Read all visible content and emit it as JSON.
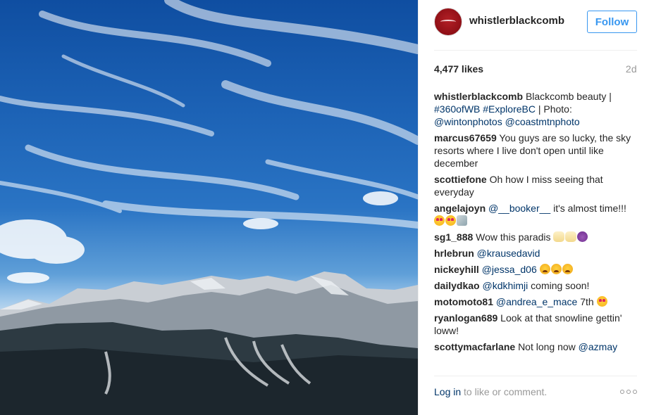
{
  "post": {
    "photo_alt": "Mountain landscape under blue sky with wispy clouds",
    "account": {
      "username": "whistlerblackcomb",
      "follow_label": "Follow"
    },
    "likes": "4,477 likes",
    "time": "2d",
    "caption": {
      "user": "whistlerblackcomb",
      "text": "Blackcomb beauty |",
      "tag1": "#360ofWB",
      "tag2": "#ExploreBC",
      "text2": "| Photo:",
      "mention1": "@wintonphotos",
      "mention2": "@coastmtnphoto"
    },
    "comments": [
      {
        "user": "marcus67659",
        "text": "You guys are so lucky, the sky resorts where I live don't open until like december"
      },
      {
        "user": "scottiefone",
        "text": "Oh how I miss seeing that everyday"
      },
      {
        "user": "angelajoyn",
        "mention": "@__booker__",
        "text": "it's almost time!!!",
        "emojis": [
          "heart-eyes",
          "heart-eyes",
          "snowboard"
        ]
      },
      {
        "user": "sg1_888",
        "text": "Wow this paradis",
        "emojis": [
          "fist",
          "fist",
          "devil"
        ]
      },
      {
        "user": "hrlebrun",
        "mention": "@krausedavid"
      },
      {
        "user": "nickeyhill",
        "mention": "@jessa_d06",
        "emojis": [
          "weary",
          "weary",
          "weary"
        ]
      },
      {
        "user": "dailydkao",
        "mention": "@kdkhimji",
        "text": "coming soon!"
      },
      {
        "user": "motomoto81",
        "mention": "@andrea_e_mace",
        "text": "7th",
        "emojis": [
          "heart-eyes"
        ]
      },
      {
        "user": "ryanlogan689",
        "text": "Look at that snowline gettin' loww!"
      },
      {
        "user": "scottymacfarlane",
        "text": "Not long now",
        "mention_after": "@azmay"
      }
    ],
    "footer": {
      "login": "Log in",
      "rest": "to like or comment.",
      "more_icon": "more-options-icon"
    }
  }
}
